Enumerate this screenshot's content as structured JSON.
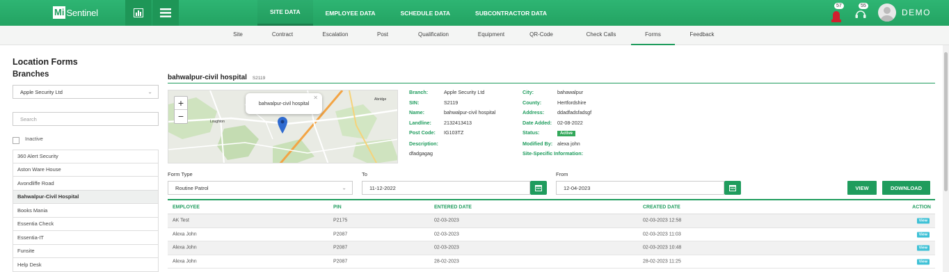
{
  "brand": {
    "logo_mi": "Mi",
    "logo_rest": "Sentinel"
  },
  "top_nav": [
    {
      "label": "SITE DATA",
      "active": true
    },
    {
      "label": "EMPLOYEE DATA",
      "active": false
    },
    {
      "label": "SCHEDULE DATA",
      "active": false
    },
    {
      "label": "SUBCONTRACTOR DATA",
      "active": false
    }
  ],
  "notifications": {
    "alerts_count": "57",
    "messages_count": "55"
  },
  "user": {
    "name": "DEMO"
  },
  "sub_nav": [
    {
      "label": "Site",
      "active": false
    },
    {
      "label": "Contract",
      "active": false
    },
    {
      "label": "Escalation",
      "active": false
    },
    {
      "label": "Post",
      "active": false
    },
    {
      "label": "Qualification",
      "active": false
    },
    {
      "label": "Equipment",
      "active": false
    },
    {
      "label": "QR-Code",
      "active": false
    },
    {
      "label": "Check Calls",
      "active": false
    },
    {
      "label": "Forms",
      "active": true
    },
    {
      "label": "Feedback",
      "active": false
    }
  ],
  "left": {
    "title": "Location Forms",
    "subtitle": "Branches",
    "branch_select": "Apple Security Ltd",
    "search_placeholder": "Search",
    "inactive_label": "Inactive",
    "branches": [
      {
        "label": "360 Alert Security",
        "active": false
      },
      {
        "label": "Aston Ware House",
        "active": false
      },
      {
        "label": "Avondliffe Road",
        "active": false
      },
      {
        "label": "Bahwalpur-Civil Hospital",
        "active": true
      },
      {
        "label": "Books Mania",
        "active": false
      },
      {
        "label": "Essentia Check",
        "active": false
      },
      {
        "label": "Essentia-IT",
        "active": false
      },
      {
        "label": "Funsite",
        "active": false
      },
      {
        "label": "Help Desk",
        "active": false
      }
    ]
  },
  "site": {
    "name": "bahwalpur-civil hospital",
    "code": "S2119",
    "map_popup": "bahwalpur-civil hospital",
    "map_places": {
      "loughton": "Loughton",
      "abridge": "Abridge"
    },
    "info_left": [
      {
        "label": "Branch:",
        "value": "Apple Security Ltd"
      },
      {
        "label": "SIN:",
        "value": "S2119"
      },
      {
        "label": "Name:",
        "value": "bahwalpur-civil hospital"
      },
      {
        "label": "Landline:",
        "value": "2132413413"
      },
      {
        "label": "Post Code:",
        "value": "IG103TZ"
      },
      {
        "label": "Description:",
        "value": ""
      }
    ],
    "description_text": "dfadgagag",
    "info_right": [
      {
        "label": "City:",
        "value": "bahawalpur"
      },
      {
        "label": "County:",
        "value": "Hertfordshire"
      },
      {
        "label": "Address:",
        "value": "ddadfadsfadsgf"
      },
      {
        "label": "Date Added:",
        "value": "02-08-2022"
      },
      {
        "label": "Status:",
        "value": "Active"
      },
      {
        "label": "Modified By:",
        "value": "alexa john"
      },
      {
        "label": "Site-Specific Information:",
        "value": ""
      }
    ]
  },
  "filters": {
    "form_type_label": "Form Type",
    "form_type_value": "Routine Patrol",
    "to_label": "To",
    "to_value": "11-12-2022",
    "from_label": "From",
    "from_value": "12-04-2023",
    "view_button": "VIEW",
    "download_button": "DOWNLOAD"
  },
  "table": {
    "headers": {
      "employee": "EMPLOYEE",
      "pin": "PIN",
      "entered": "ENTERED DATE",
      "created": "CREATED DATE",
      "action": "ACTION"
    },
    "rows": [
      {
        "employee": "AK Test",
        "pin": "P2175",
        "entered": "02-03-2023",
        "created": "02-03-2023 12:58",
        "action": "View"
      },
      {
        "employee": "Alexa John",
        "pin": "P2087",
        "entered": "02-03-2023",
        "created": "02-03-2023 11:03",
        "action": "View"
      },
      {
        "employee": "Alexa John",
        "pin": "P2087",
        "entered": "02-03-2023",
        "created": "02-03-2023 10:48",
        "action": "View"
      },
      {
        "employee": "Alexa John",
        "pin": "P2087",
        "entered": "28-02-2023",
        "created": "28-02-2023 11:25",
        "action": "View"
      }
    ]
  },
  "colors": {
    "brand_green": "#1f9c5d",
    "accent_cyan": "#3ec1d6",
    "alert_red": "#d0202e"
  },
  "icons": [
    "chart-icon",
    "menu-icon",
    "alarm-icon",
    "headset-icon",
    "chevron-down-icon",
    "calendar-icon",
    "map-marker-icon",
    "close-icon"
  ]
}
